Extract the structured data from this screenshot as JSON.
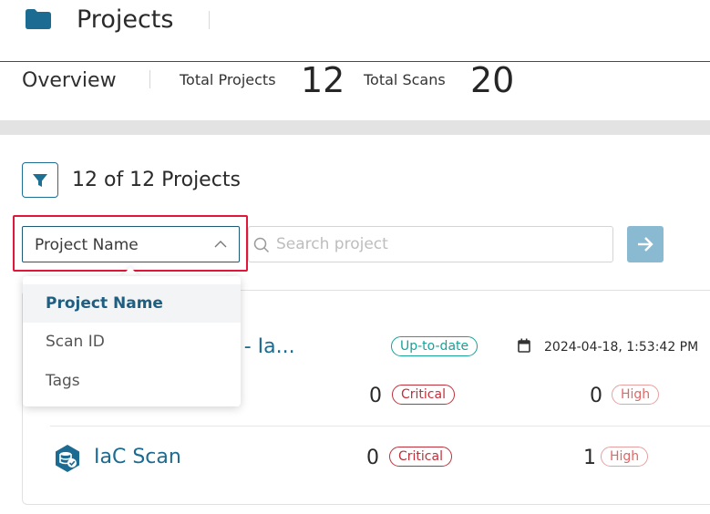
{
  "header": {
    "title": "Projects",
    "icon": "folder-icon"
  },
  "overview": {
    "label": "Overview",
    "total_projects_label": "Total Projects",
    "total_projects_value": "12",
    "total_scans_label": "Total Scans",
    "total_scans_value": "20"
  },
  "filter": {
    "count_text": "12 of 12 Projects",
    "selected_field": "Project Name",
    "search_placeholder": "Search project",
    "options": [
      {
        "label": "Project Name",
        "selected": true
      },
      {
        "label": "Scan ID",
        "selected": false
      },
      {
        "label": "Tags",
        "selected": false
      }
    ]
  },
  "rows": [
    {
      "name": "ct - Ia...",
      "status": "Up-to-date",
      "date": "2024-04-18, 1:53:42 PM",
      "critical_count": "0",
      "critical_label": "Critical",
      "high_count": "0",
      "high_label": "High"
    },
    {
      "name": "IaC Scan",
      "critical_count": "0",
      "critical_label": "Critical",
      "high_count": "1",
      "high_label": "High"
    }
  ],
  "colors": {
    "brand": "#1d5a78",
    "link": "#1b6b92",
    "highlight": "#e0173a",
    "status_ok": "#16a398",
    "critical": "#c0303a",
    "high": "#e06767"
  }
}
